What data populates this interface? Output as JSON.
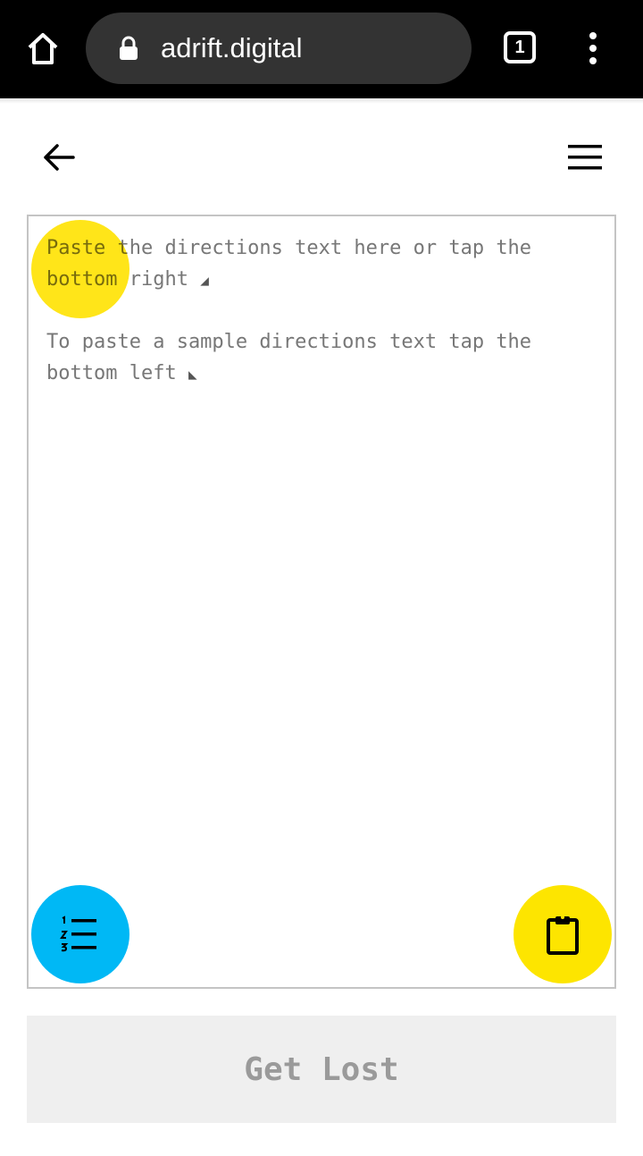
{
  "browser": {
    "url": "adrift.digital",
    "tab_count": "1",
    "icons": [
      "home-icon",
      "lock-icon",
      "tabs-icon",
      "more-vert-icon"
    ]
  },
  "header": {
    "icons": [
      "arrow-left-icon",
      "hamburger-menu-icon"
    ]
  },
  "editor": {
    "hint_paste": "Paste the directions text here or tap the bottom right",
    "hint_paste_marker": "◢",
    "hint_sample": "To paste a sample directions text tap the bottom left",
    "hint_sample_marker": "◣"
  },
  "fab": {
    "sample_icon": "numbered-list-icon",
    "paste_icon": "clipboard-icon"
  },
  "actions": {
    "get_lost_label": "Get Lost"
  },
  "colors": {
    "highlight_yellow": "#fde500",
    "sample_blue": "#00b8f5",
    "browser_bar": "#000000",
    "button_bg": "#efefef",
    "button_text": "#9a9a9a",
    "hint_text": "#777777"
  }
}
